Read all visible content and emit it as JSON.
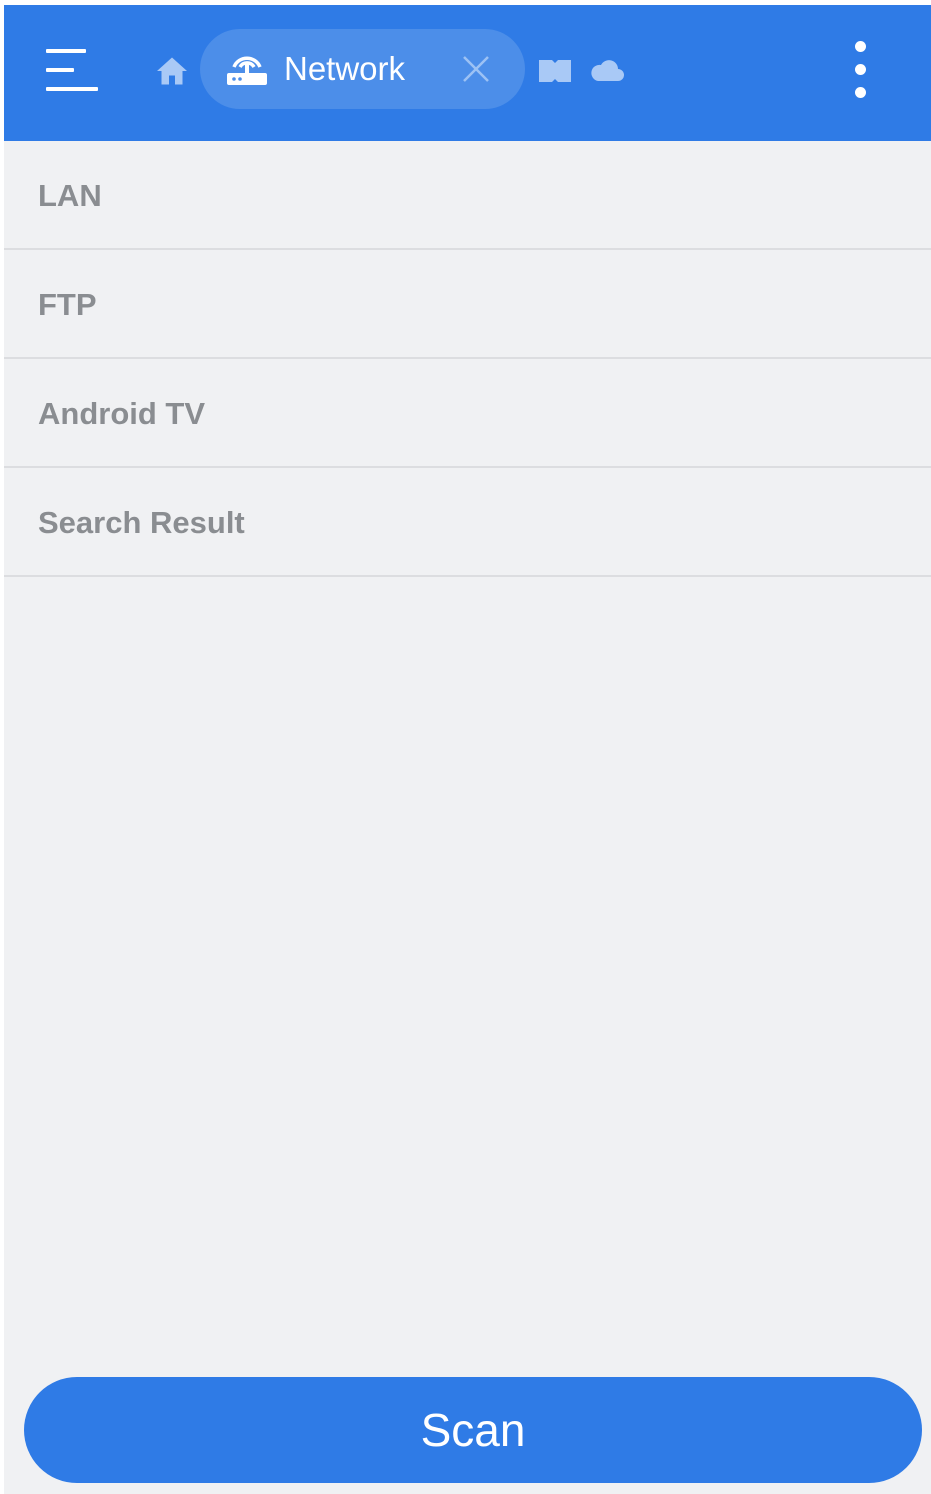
{
  "colors": {
    "appbar": "#2f7be6",
    "tab_chip": "#4c8ee9",
    "background": "#f0f1f3",
    "row_text": "#8a8d91",
    "divider": "#dcdde0",
    "primary_button": "#2f7be6"
  },
  "toolbar": {
    "menu_icon": "hamburger-menu-icon",
    "home_icon": "home-icon",
    "active_tab": {
      "icon": "router-icon",
      "label": "Network",
      "close_icon": "close-icon"
    },
    "extra_tab_icons": [
      "bookmark-icon",
      "cloud-icon"
    ],
    "more_icon": "more-vertical-icon"
  },
  "network_list": [
    {
      "label": "LAN"
    },
    {
      "label": "FTP"
    },
    {
      "label": "Android TV"
    },
    {
      "label": "Search Result"
    }
  ],
  "scan_button": {
    "label": "Scan"
  }
}
